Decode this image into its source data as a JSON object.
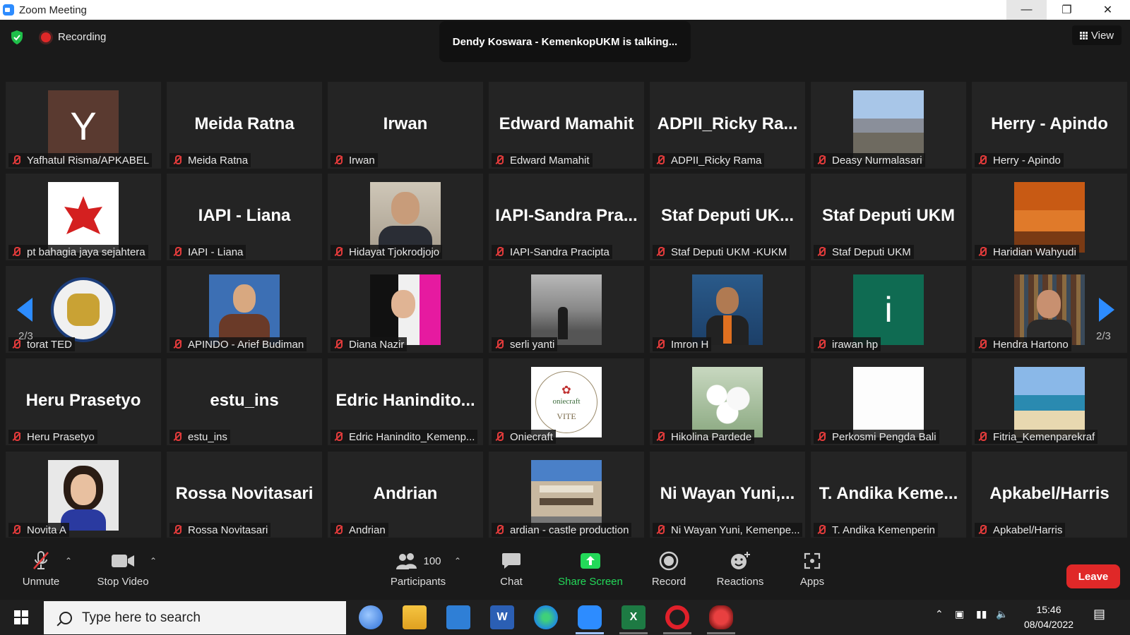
{
  "window": {
    "title": "Zoom Meeting"
  },
  "topbar": {
    "recording": "Recording",
    "talking": "Dendy Koswara - KemenkopUKM is talking...",
    "view": "View"
  },
  "pager": {
    "left": "2/3",
    "right": "2/3"
  },
  "tiles": [
    {
      "label": "Yafhatul Risma/APKABEL",
      "big": "",
      "photo": "avatar-y"
    },
    {
      "label": "Meida Ratna",
      "big": "Meida Ratna"
    },
    {
      "label": "Irwan",
      "big": "Irwan"
    },
    {
      "label": "Edward Mamahit",
      "big": "Edward Mamahit"
    },
    {
      "label": "ADPII_Ricky Rama",
      "big": "ADPII_Ricky Ra..."
    },
    {
      "label": "Deasy Nurmalasari",
      "big": "",
      "photo": "seaside"
    },
    {
      "label": "Herry - Apindo",
      "big": "Herry - Apindo"
    },
    {
      "label": "pt bahagia jaya sejahtera",
      "big": "",
      "photo": "logo-red"
    },
    {
      "label": "IAPI - Liana",
      "big": "IAPI - Liana"
    },
    {
      "label": "Hidayat Tjokrodjojo",
      "big": "",
      "photo": "portrait-man"
    },
    {
      "label": "IAPI-Sandra Pracipta",
      "big": "IAPI-Sandra Pra..."
    },
    {
      "label": "Staf Deputi UKM -KUKM",
      "big": "Staf Deputi UK..."
    },
    {
      "label": "Staf Deputi UKM",
      "big": "Staf Deputi UKM"
    },
    {
      "label": "Haridian Wahyudi",
      "big": "",
      "photo": "talkshow"
    },
    {
      "label": "torat TED",
      "big": "",
      "photo": "emblem"
    },
    {
      "label": "APINDO - Arief Budiman",
      "big": "",
      "photo": "man-blue"
    },
    {
      "label": "Diana Nazir",
      "big": "",
      "photo": "woman-pink"
    },
    {
      "label": "serli yanti",
      "big": "",
      "photo": "sunset"
    },
    {
      "label": "Imron H",
      "big": "",
      "photo": "man-boat"
    },
    {
      "label": "irawan hp",
      "big": "",
      "photo": "avatar-i"
    },
    {
      "label": "Hendra Hartono",
      "big": "",
      "photo": "man-books"
    },
    {
      "label": "Heru Prasetyo",
      "big": "Heru Prasetyo"
    },
    {
      "label": "estu_ins",
      "big": "estu_ins"
    },
    {
      "label": "Edric Hanindito_Kemenp...",
      "big": "Edric Hanindito..."
    },
    {
      "label": "Oniecraft",
      "big": "",
      "photo": "oniecraft"
    },
    {
      "label": "Hikolina Pardede",
      "big": "",
      "photo": "flowers"
    },
    {
      "label": "Perkosmi Pengda Bali",
      "big": "",
      "photo": "white"
    },
    {
      "label": "Fitria_Kemenparekraf",
      "big": "",
      "photo": "beach"
    },
    {
      "label": "Novita A",
      "big": "",
      "photo": "woman-smile"
    },
    {
      "label": "Rossa Novitasari",
      "big": "Rossa Novitasari"
    },
    {
      "label": "Andrian",
      "big": "Andrian"
    },
    {
      "label": "ardian - castle production",
      "big": "",
      "photo": "building"
    },
    {
      "label": "Ni Wayan Yuni, Kemenpe...",
      "big": "Ni Wayan Yuni,..."
    },
    {
      "label": "T. Andika Kemenperin",
      "big": "T. Andika Keme..."
    },
    {
      "label": "Apkabel/Harris",
      "big": "Apkabel/Harris"
    }
  ],
  "photo_text": {
    "avatar-y": "Y",
    "avatar-i": "i",
    "oniecraft": "oniecraft",
    "vite": "VITE"
  },
  "toolbar": {
    "unmute": "Unmute",
    "stop_video": "Stop Video",
    "participants": "Participants",
    "participants_count": "100",
    "chat": "Chat",
    "share": "Share Screen",
    "record": "Record",
    "reactions": "Reactions",
    "apps": "Apps",
    "leave": "Leave"
  },
  "taskbar": {
    "search_placeholder": "Type here to search",
    "time": "15:46",
    "date": "08/04/2022"
  },
  "colors": {
    "accent": "#2d8cff",
    "leave": "#e02828",
    "share": "#23d959",
    "mic_muted": "#e23b3b"
  }
}
